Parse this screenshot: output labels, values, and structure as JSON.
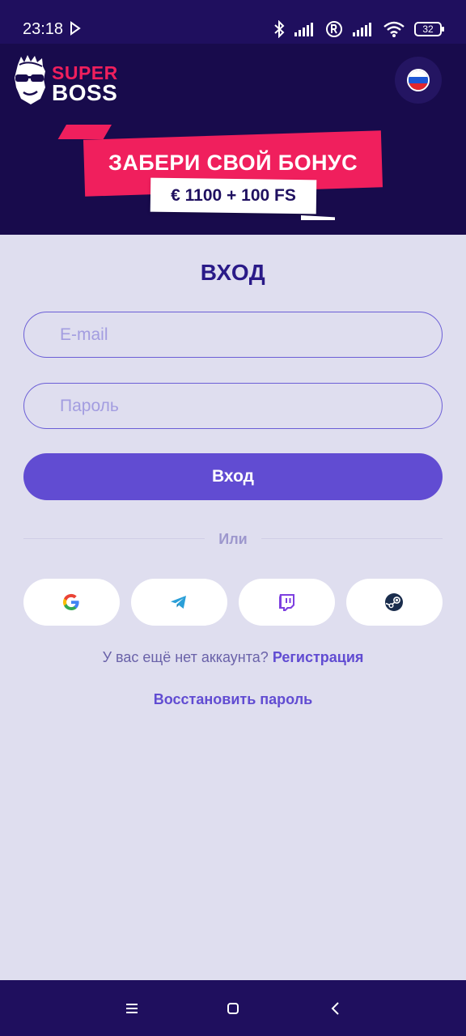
{
  "status_bar": {
    "time": "23:18",
    "battery": "32"
  },
  "header": {
    "logo": {
      "line1": "SUPER",
      "line2": "BOSS"
    },
    "language_icon": "russian-flag-icon"
  },
  "banner": {
    "title": "ЗАБЕРИ СВОЙ БОНУС",
    "amount": "€ 1100 + 100 FS"
  },
  "login": {
    "title": "ВХОД",
    "email_placeholder": "E-mail",
    "password_placeholder": "Пароль",
    "submit_label": "Вход",
    "divider": "Или",
    "social": [
      "google-icon",
      "telegram-icon",
      "twitch-icon",
      "steam-icon"
    ],
    "register_prompt": "У вас ещё нет аккаунта?",
    "register_link": "Регистрация",
    "restore_link": "Восстановить пароль"
  },
  "colors": {
    "header_bg": "#180b4c",
    "accent": "#614cd2",
    "banner_red": "#f01f5d",
    "page_bg": "#dfdeef"
  }
}
